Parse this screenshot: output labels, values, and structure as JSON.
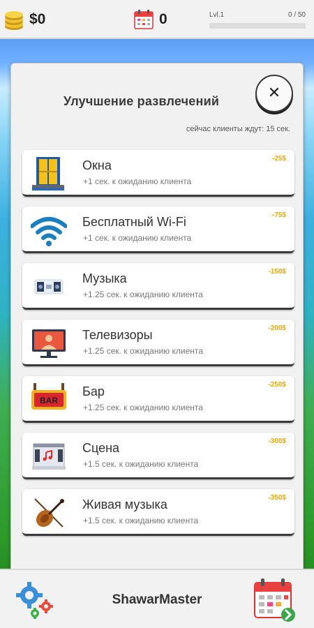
{
  "topbar": {
    "money": "$0",
    "days": "0",
    "level": "Lvl.1",
    "xp": "0 / 50",
    "xp_progress": 0
  },
  "panel": {
    "title": "Улучшение развлечений",
    "close_label": "✕",
    "wait_note": "сейчас клиенты ждут: 15 сек."
  },
  "items": [
    {
      "name": "Окна",
      "desc": "+1 сек. к ожиданию клиента",
      "price": "-25$",
      "icon": "window-icon"
    },
    {
      "name": "Бесплатный Wi-Fi",
      "desc": "+1 сек. к ожиданию клиента",
      "price": "-75$",
      "icon": "wifi-icon"
    },
    {
      "name": "Музыка",
      "desc": "+1.25 сек. к ожиданию клиента",
      "price": "-150$",
      "icon": "speakers-icon"
    },
    {
      "name": "Телевизоры",
      "desc": "+1.25 сек. к ожиданию клиента",
      "price": "-200$",
      "icon": "tv-icon"
    },
    {
      "name": "Бар",
      "desc": "+1.25 сек. к ожиданию клиента",
      "price": "-250$",
      "icon": "bar-sign-icon"
    },
    {
      "name": "Сцена",
      "desc": "+1.5 сек. к ожиданию клиента",
      "price": "-300$",
      "icon": "stage-icon"
    },
    {
      "name": "Живая музыка",
      "desc": "+1.5 сек. к ожиданию клиента",
      "price": "-350$",
      "icon": "violin-icon"
    }
  ],
  "bar_sign_text": "BAR",
  "bottombar": {
    "title": "ShawarMaster"
  },
  "colors": {
    "price": "#f0a800",
    "accent_green": "#4caf50"
  }
}
